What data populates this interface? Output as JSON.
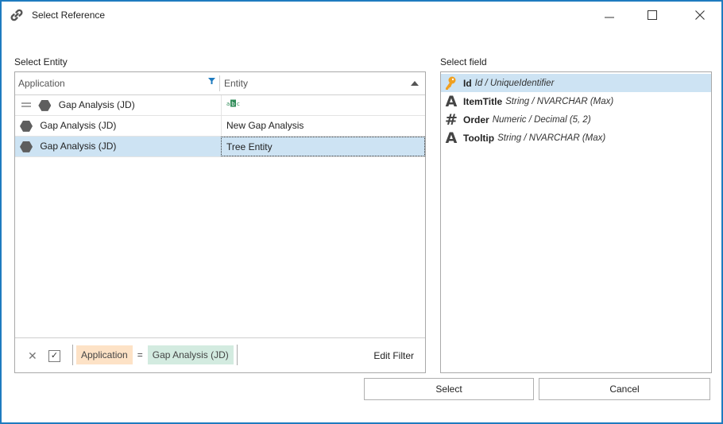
{
  "window": {
    "title": "Select Reference",
    "icon": "link-icon",
    "controls": {
      "minimize": "—",
      "maximize": "☐",
      "close": "✕"
    }
  },
  "entity_panel": {
    "label": "Select Entity",
    "columns": [
      "Application",
      "Entity"
    ],
    "rows": [
      {
        "application": "Gap Analysis (JD)",
        "entity": "",
        "entity_icon": "abc-text-icon",
        "grouped": true,
        "selected": false
      },
      {
        "application": "Gap Analysis (JD)",
        "entity": "New Gap Analysis",
        "selected": false
      },
      {
        "application": "Gap Analysis (JD)",
        "entity": "Tree Entity",
        "selected": true
      }
    ],
    "filter": {
      "field": "Application",
      "operator": "=",
      "value": "Gap Analysis (JD)",
      "checked": true,
      "edit_label": "Edit Filter"
    }
  },
  "field_panel": {
    "label": "Select field",
    "fields": [
      {
        "name": "Id",
        "type": "Id / UniqueIdentifier",
        "icon": "key-icon",
        "selected": true
      },
      {
        "name": "ItemTitle",
        "type": "String / NVARCHAR (Max)",
        "icon": "text-a-icon",
        "selected": false
      },
      {
        "name": "Order",
        "type": "Numeric / Decimal (5, 2)",
        "icon": "hash-icon",
        "selected": false
      },
      {
        "name": "Tooltip",
        "type": "String / NVARCHAR (Max)",
        "icon": "text-a-icon",
        "selected": false
      }
    ]
  },
  "buttons": {
    "select": "Select",
    "cancel": "Cancel"
  },
  "colors": {
    "accent": "#1e7bbf",
    "selection": "#cde3f3",
    "filter_field": "#fde2c6",
    "filter_value": "#d3ebe0",
    "key": "#f0a020"
  }
}
